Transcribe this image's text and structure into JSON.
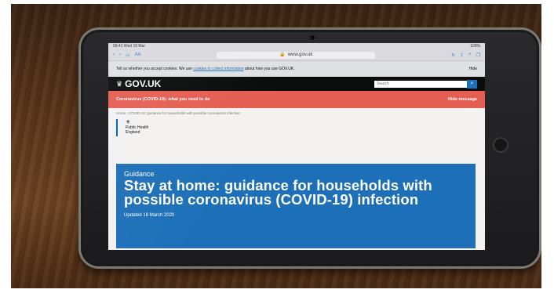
{
  "status_bar": {
    "time": "09:41 Wed 18 Mar",
    "battery": "100%"
  },
  "browser": {
    "tabs_label": "AA",
    "domain": "www.gov.uk",
    "lock_icon": "lock-icon",
    "back_icon": "chevron-left-icon",
    "forward_icon": "chevron-right-icon",
    "reader_icon": "book-icon",
    "share_icon": "share-icon",
    "add_icon": "plus-icon",
    "tabs_icon": "tabs-icon"
  },
  "cookie_banner": {
    "text": "Tell us whether you accept cookies. We use",
    "link_text": "cookies to collect information",
    "text_tail": "about how you use GOV.UK.",
    "hide_label": "Hide"
  },
  "header": {
    "logo_text": "GOV.UK",
    "search_placeholder": "Search",
    "search_icon": "magnifier-icon"
  },
  "alert": {
    "text": "Coronavirus (COVID-19): what you need to do",
    "action": "Hide message"
  },
  "breadcrumb": {
    "home": "Home",
    "separator": "›",
    "current": "COVID-19: guidance for households with possible coronavirus infection"
  },
  "organisation": {
    "line1": "Public Health",
    "line2": "England"
  },
  "hero": {
    "kicker": "Guidance",
    "title": "Stay at home: guidance for households with possible coronavirus (COVID-19) infection",
    "updated": "Updated 18 March 2020"
  },
  "colors": {
    "gov_blue": "#1d70b8",
    "alert_red": "#e55e52",
    "header_black": "#0b0c0c"
  }
}
